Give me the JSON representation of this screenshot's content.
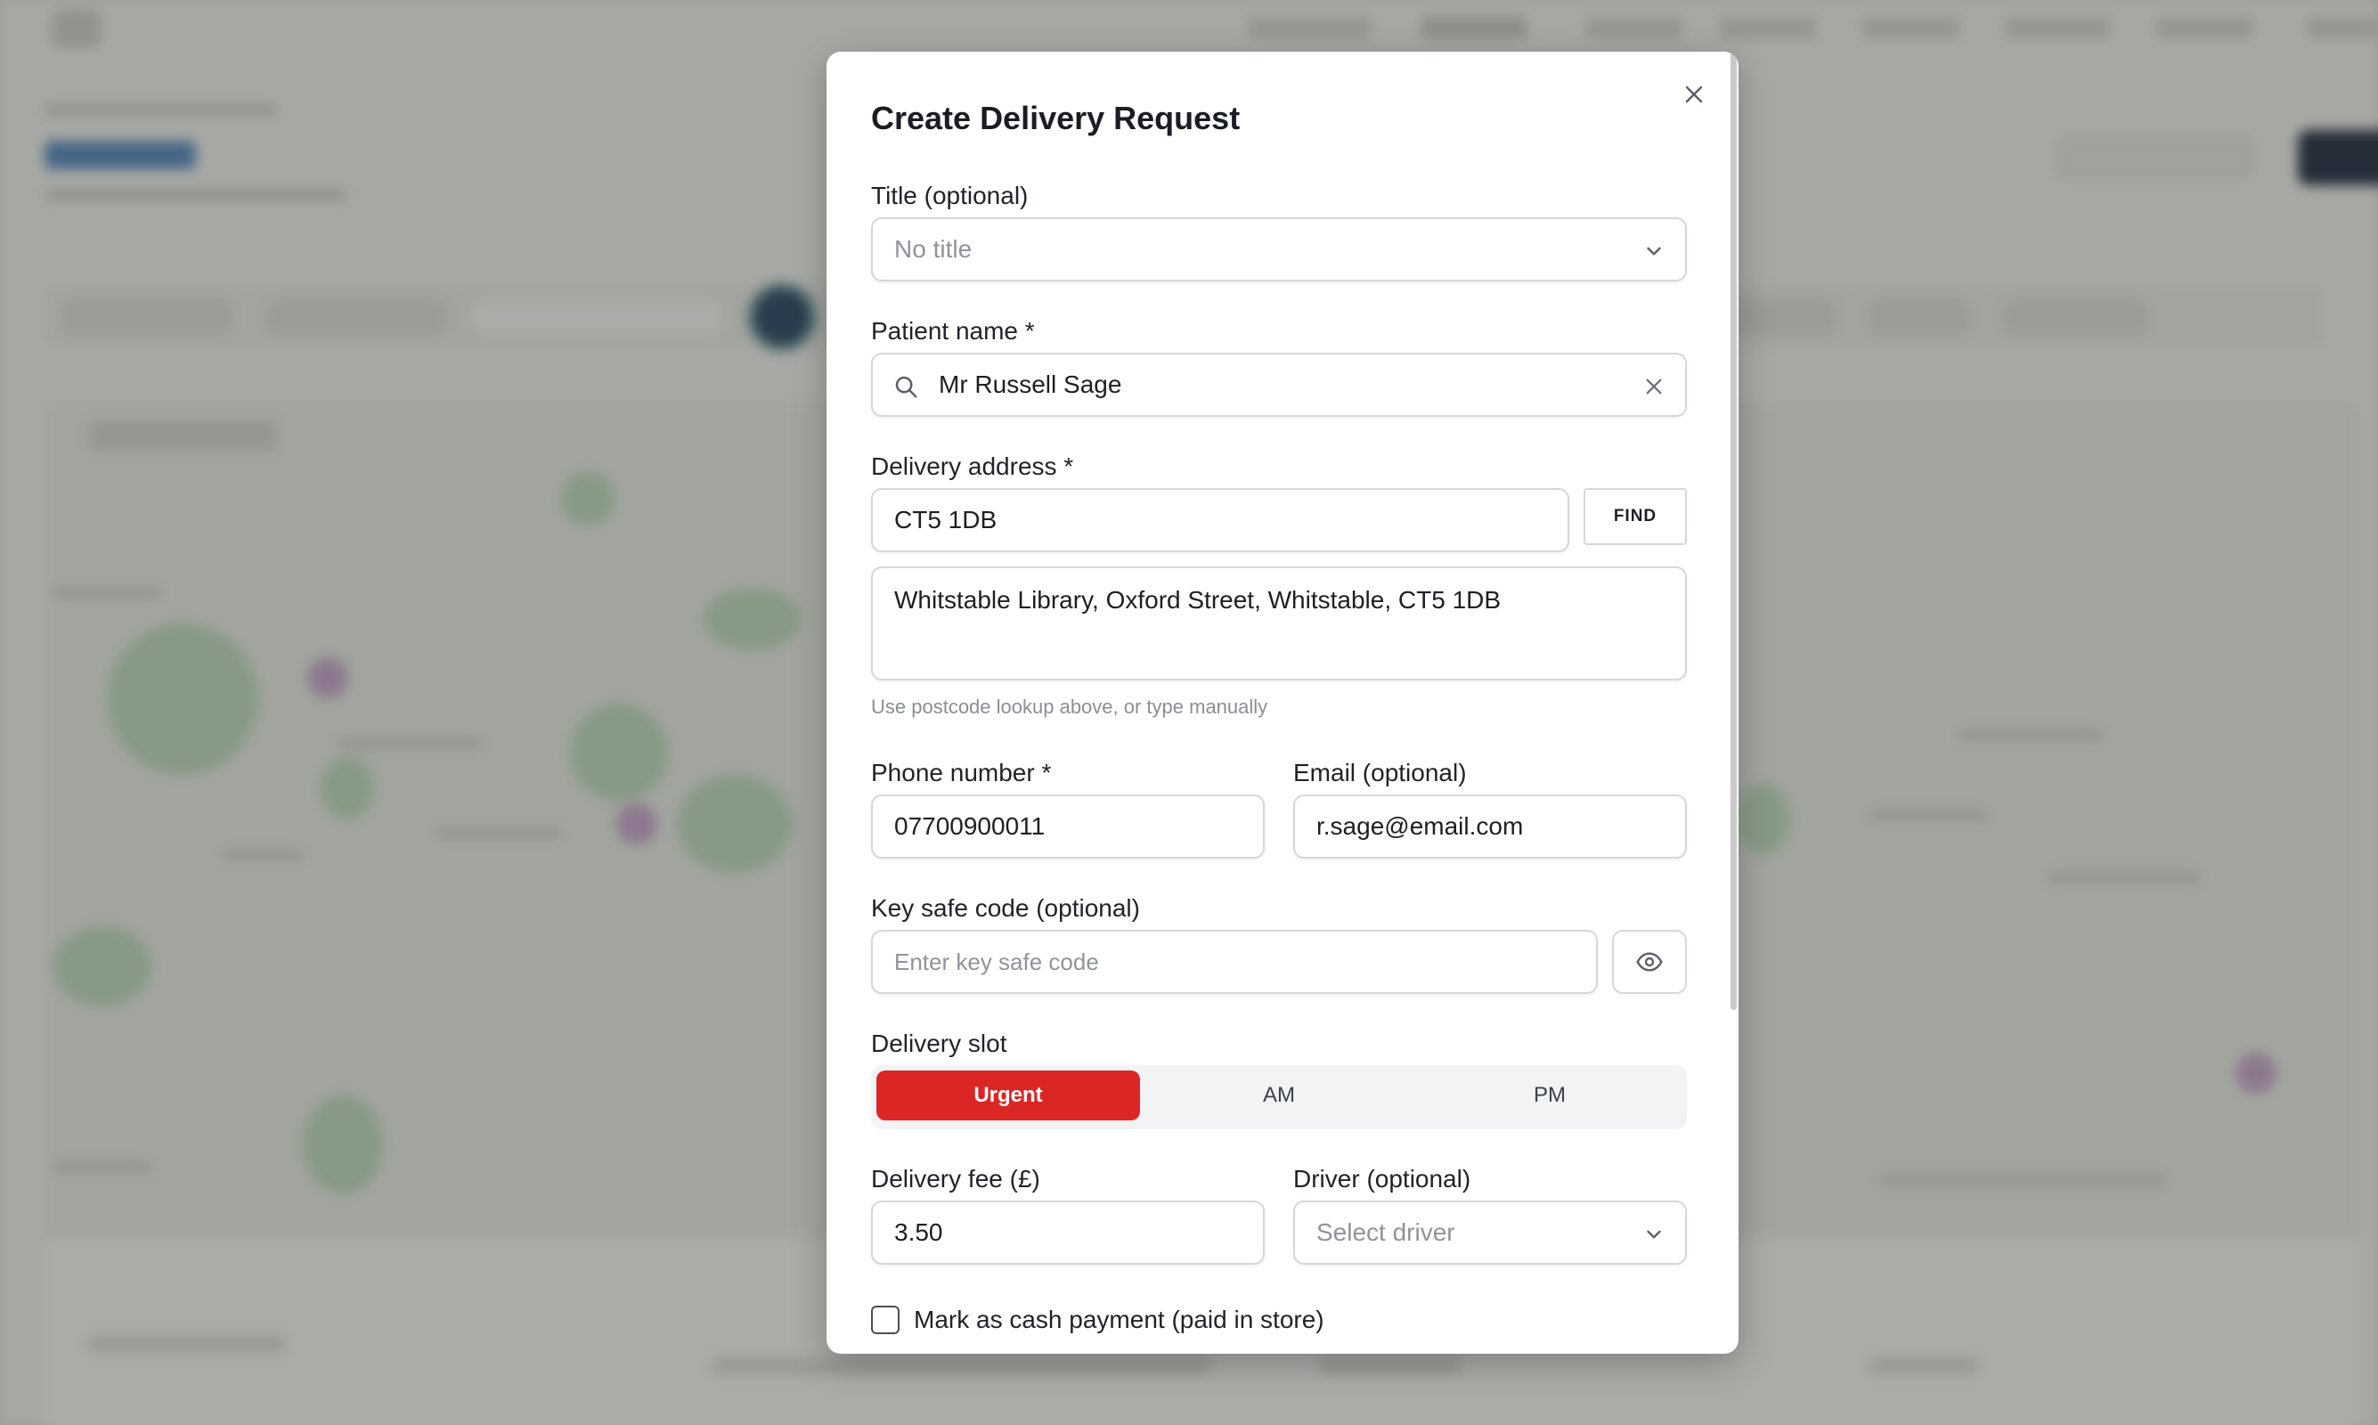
{
  "modal": {
    "title": "Create Delivery Request",
    "close_icon": "close-icon"
  },
  "form": {
    "title_field": {
      "label": "Title (optional)",
      "placeholder": "No title",
      "icon": "chevron-down-icon"
    },
    "patient_name": {
      "label": "Patient name *",
      "value": "Mr Russell Sage",
      "lead_icon": "search-icon",
      "clear_icon": "clear-icon"
    },
    "delivery_address": {
      "label": "Delivery address *",
      "postcode_value": "CT5 1DB",
      "find_label": "FIND",
      "address_value": "Whitstable Library, Oxford Street, Whitstable, CT5 1DB",
      "hint": "Use postcode lookup above, or type manually"
    },
    "phone": {
      "label": "Phone number *",
      "value": "07700900011"
    },
    "email": {
      "label": "Email (optional)",
      "value": "r.sage@email.com"
    },
    "key_safe": {
      "label": "Key safe code (optional)",
      "placeholder": "Enter key safe code",
      "toggle_icon": "eye-icon"
    },
    "delivery_slot": {
      "label": "Delivery slot",
      "options": [
        "Urgent",
        "AM",
        "PM"
      ],
      "selected": "Urgent"
    },
    "delivery_fee": {
      "label": "Delivery fee (£)",
      "value": "3.50"
    },
    "driver": {
      "label": "Driver (optional)",
      "placeholder": "Select driver",
      "icon": "chevron-down-icon"
    },
    "cash_payment": {
      "label": "Mark as cash payment (paid in store)",
      "checked": false
    }
  },
  "colors": {
    "accent_red": "#dc2626",
    "text": "#1f2329",
    "border": "#d4d7dc"
  }
}
